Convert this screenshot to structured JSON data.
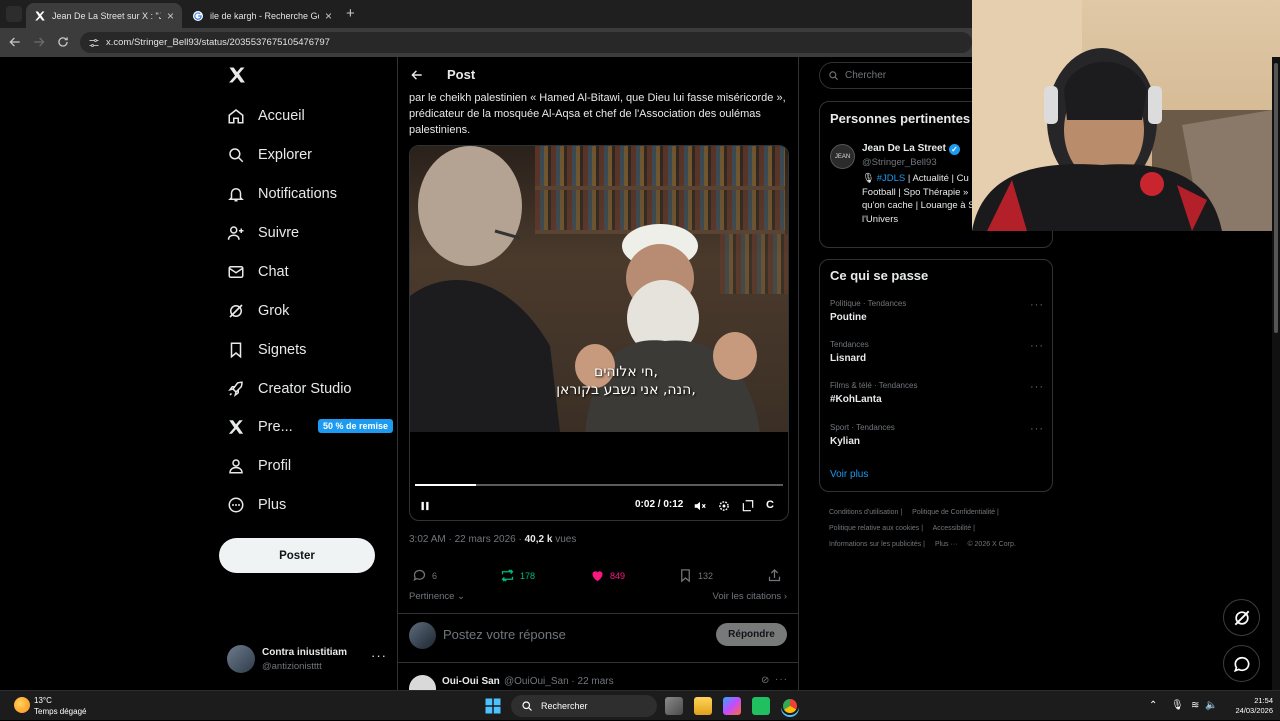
{
  "browser": {
    "tabs": [
      {
        "title": "Jean De La Street sur X : \"Je jur"
      },
      {
        "title": "ile de kargh - Recherche Google"
      }
    ],
    "url": "x.com/Stringer_Bell93/status/2035537675105476797"
  },
  "nav": {
    "items": [
      {
        "label": "Accueil",
        "icon": "home-icon"
      },
      {
        "label": "Explorer",
        "icon": "search-icon"
      },
      {
        "label": "Notifications",
        "icon": "bell-icon"
      },
      {
        "label": "Suivre",
        "icon": "person-add-icon"
      },
      {
        "label": "Chat",
        "icon": "mail-icon"
      },
      {
        "label": "Grok",
        "icon": "grok-icon"
      },
      {
        "label": "Signets",
        "icon": "bookmark-icon"
      },
      {
        "label": "Creator Studio",
        "icon": "rocket-icon"
      },
      {
        "label": "Pre...",
        "icon": "x-icon"
      },
      {
        "label": "Profil",
        "icon": "person-icon"
      },
      {
        "label": "Plus",
        "icon": "more-circle-icon"
      }
    ],
    "premium_badge": "50 % de remise",
    "post_button": "Poster",
    "account": {
      "name": "Contra iniustitiam",
      "handle": "@antizionistttt"
    }
  },
  "post": {
    "header": "Post",
    "text": "par le cheikh palestinien « Hamed Al-Bitawi, que Dieu lui fasse miséricorde », prédicateur de la mosquée Al-Aqsa et chef de l'Association des oulémas palestiniens.",
    "video": {
      "subtitle_line1": "חי אלוהים,",
      "subtitle_line2": "הנה, אני נשבע בקוראן,",
      "time": "0:02 / 0:12",
      "progress": 0.167,
      "corner_label": "C"
    },
    "meta": {
      "time": "3:02 AM · 22 mars 2026 · ",
      "views": "40,2 k",
      "views_label": " vues"
    },
    "actions": {
      "replies": "6",
      "reposts": "178",
      "likes": "849",
      "bookmarks": "132"
    },
    "sort_label": "Pertinence",
    "quotes_label": "Voir les citations",
    "reply_placeholder": "Postez votre réponse",
    "reply_button": "Répondre",
    "next_reply": {
      "name": "Oui-Oui San",
      "handle": "@OuiOui_San · 22 mars"
    }
  },
  "sidebar": {
    "search_placeholder": "Chercher",
    "relevant": {
      "title": "Personnes pertinentes",
      "avatar_text": "JEAN",
      "name": "Jean De La Street",
      "handle": "@Stringer_Bell93",
      "bio_tag": "#JDLS",
      "bio": " | Actualité | Cu Politique | Football | Spo Thérapie » 🍀 | Ce qu'on qu'on cache | Louange à Seigneur de l'Univers"
    },
    "trends_title": "Ce qui se passe",
    "trends": [
      {
        "category": "Politique · Tendances",
        "name": "Poutine"
      },
      {
        "category": "Tendances",
        "name": "Lisnard"
      },
      {
        "category": "Films & télé · Tendances",
        "name": "#KohLanta"
      },
      {
        "category": "Sport · Tendances",
        "name": "Kylian"
      }
    ],
    "show_more": "Voir plus",
    "footer": [
      "Conditions d'utilisation |",
      "Politique de Confidentialité |",
      "Politique relative aux cookies |",
      "Accessibilité |",
      "Informations sur les publicités |",
      "Plus ··· ",
      "© 2026 X Corp."
    ]
  },
  "taskbar": {
    "temp": "13°C",
    "weather": "Temps dégagé",
    "search": "Rechercher",
    "time": "21:54",
    "date": "24/03/2026"
  },
  "colors": {
    "accent": "#1d9bf0",
    "repost": "#00ba7c",
    "like": "#f91880"
  }
}
